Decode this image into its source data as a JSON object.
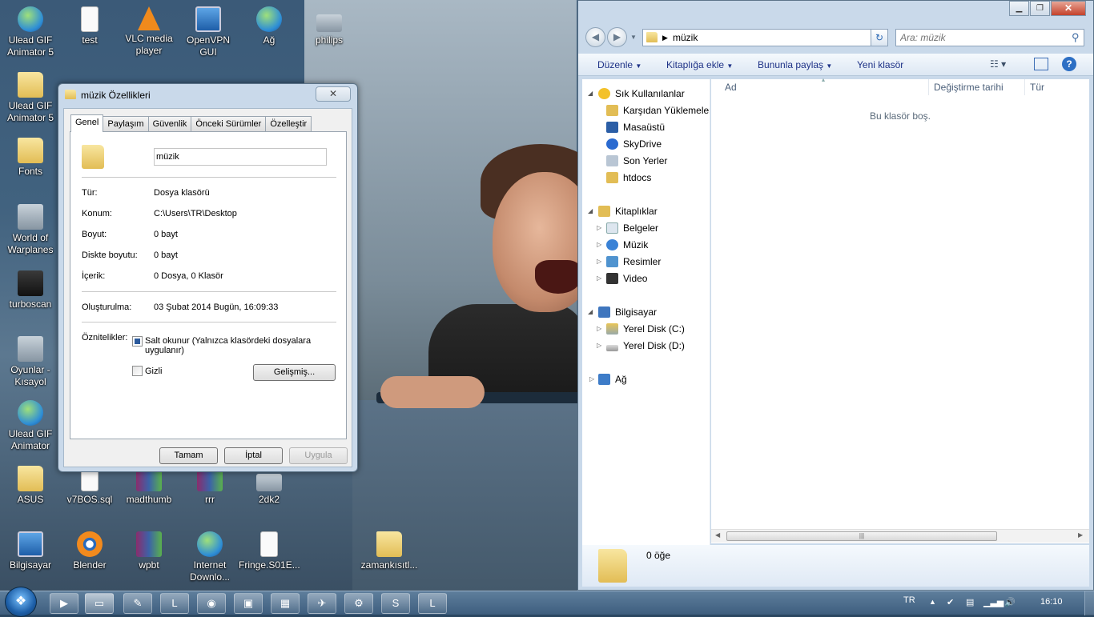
{
  "desktop": {
    "icons": [
      {
        "label": "Ulead GIF\nAnimator 5",
        "icon": "ulead-icon"
      },
      {
        "label": "test",
        "icon": "file-icon"
      },
      {
        "label": "VLC media\nplayer",
        "icon": "vlc-icon"
      },
      {
        "label": "OpenVPN\nGUI",
        "icon": "openvpn-icon"
      },
      {
        "label": "Ağ",
        "icon": "network-icon"
      },
      {
        "label": "philips",
        "icon": "philips-icon"
      },
      {
        "label": "Ulead GIF\nAnimator 5",
        "icon": "folder-icon"
      },
      {
        "label": "Fonts",
        "icon": "folder-icon"
      },
      {
        "label": "World of\nWarplanes",
        "icon": "warplanes-icon"
      },
      {
        "label": "turboscan",
        "icon": "turboscan-icon"
      },
      {
        "label": "Oyunlar -\nKısayol",
        "icon": "games-icon"
      },
      {
        "label": "Ulead GIF\nAnimator",
        "icon": "ulead-icon"
      },
      {
        "label": "ASUS",
        "icon": "folder-icon"
      },
      {
        "label": "v7BOS.sql",
        "icon": "file-icon"
      },
      {
        "label": "madthumb",
        "icon": "rar-icon"
      },
      {
        "label": "rrr",
        "icon": "rar-icon"
      },
      {
        "label": "2dk2",
        "icon": "image-icon"
      },
      {
        "label": "Bilgisayar",
        "icon": "computer-icon"
      },
      {
        "label": "Blender",
        "icon": "blender-icon"
      },
      {
        "label": "wpbt",
        "icon": "rar-icon"
      },
      {
        "label": "Internet\nDownlo...",
        "icon": "idm-icon"
      },
      {
        "label": "Fringe.S01E...",
        "icon": "file-icon"
      },
      {
        "label": "zamankısıtl...",
        "icon": "folder-icon"
      }
    ]
  },
  "dialog": {
    "title": "müzik Özellikleri",
    "close": "✕",
    "tabs": [
      "Genel",
      "Paylaşım",
      "Güvenlik",
      "Önceki Sürümler",
      "Özelleştir"
    ],
    "name_value": "müzik",
    "props": [
      {
        "label": "Tür:",
        "value": "Dosya klasörü"
      },
      {
        "label": "Konum:",
        "value": "C:\\Users\\TR\\Desktop"
      },
      {
        "label": "Boyut:",
        "value": "0 bayt"
      },
      {
        "label": "Diskte boyutu:",
        "value": "0 bayt"
      },
      {
        "label": "İçerik:",
        "value": "0 Dosya, 0 Klasör"
      }
    ],
    "created_label": "Oluşturulma:",
    "created_value": "03 Şubat 2014 Bugün, 16:09:33",
    "attributes_label": "Öznitelikler:",
    "readonly_label": "Salt okunur (Yalnızca klasördeki dosyalara uygulanır)",
    "readonly_checked": true,
    "hidden_label": "Gizli",
    "hidden_checked": false,
    "advanced_button": "Gelişmiş...",
    "ok_button": "Tamam",
    "cancel_button": "İptal",
    "apply_button": "Uygula"
  },
  "explorer": {
    "address": "müzik",
    "search_placeholder": "Ara: müzik",
    "toolbar": {
      "organize": "Düzenle",
      "library": "Kitaplığa ekle",
      "share": "Bununla paylaş",
      "new_folder": "Yeni klasör"
    },
    "nav": {
      "favorites": "Sık Kullanılanlar",
      "favorites_items": [
        "Karşıdan Yüklemeler",
        "Masaüstü",
        "SkyDrive",
        "Son Yerler",
        "htdocs"
      ],
      "libraries": "Kitaplıklar",
      "libraries_items": [
        "Belgeler",
        "Müzik",
        "Resimler",
        "Video"
      ],
      "computer": "Bilgisayar",
      "computer_items": [
        "Yerel Disk (C:)",
        "Yerel Disk (D:)"
      ],
      "network": "Ağ"
    },
    "columns": {
      "name": "Ad",
      "date": "Değiştirme tarihi",
      "type": "Tür"
    },
    "empty_message": "Bu klasör boş.",
    "details_count": "0 öğe"
  },
  "taskbar": {
    "language": "TR",
    "clock": "16:10"
  }
}
